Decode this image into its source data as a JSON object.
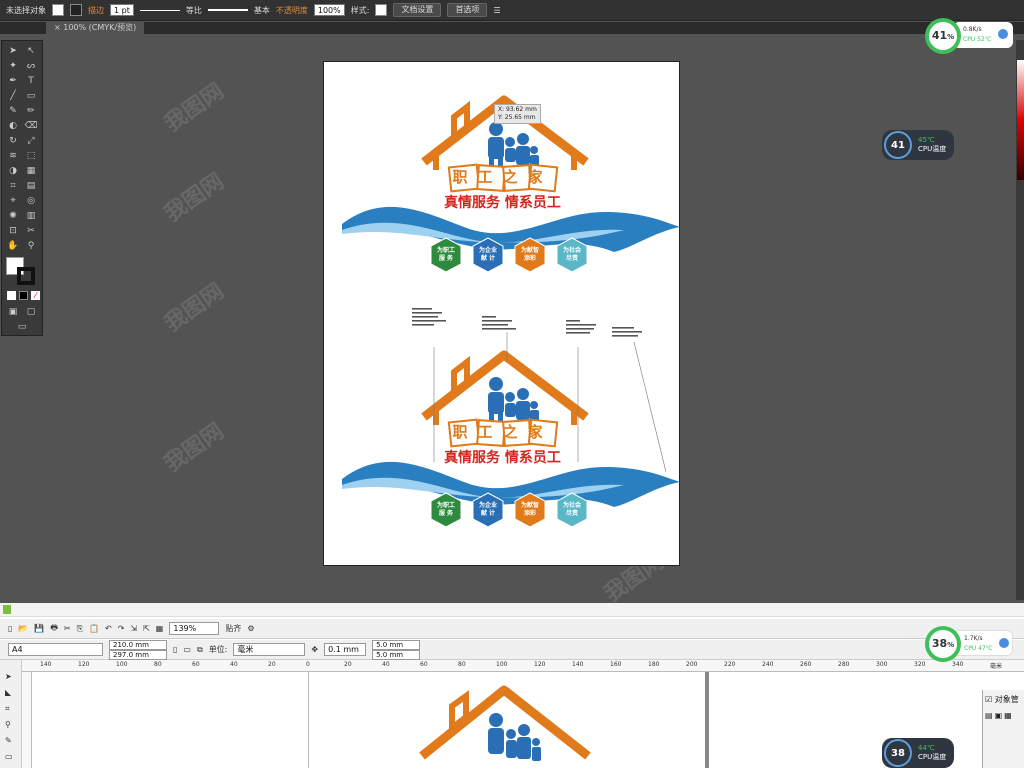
{
  "illustrator": {
    "control": {
      "selection": "未选择对象",
      "stroke_label": "描边",
      "stroke_value": "1 pt",
      "stroke_profile": "等比",
      "brush": "基本",
      "opacity_label": "不透明度",
      "opacity_value": "100%",
      "style_label": "样式:",
      "doc_setup": "文档设置",
      "prefs": "首选项"
    },
    "tab": "100% (CMYK/预览)",
    "tooltip": {
      "x": "X: 93.62 mm",
      "y": "Y: 25.65 mm"
    }
  },
  "design": {
    "title": "职工之家",
    "slogan": "真情服务 情系员工",
    "badges": [
      {
        "line1": "为职工",
        "line2": "服 务",
        "color": "#2e8b3e"
      },
      {
        "line1": "为企业",
        "line2": "献 计",
        "color": "#2a6fb6"
      },
      {
        "line1": "为献智",
        "line2": "添彩",
        "color": "#e07a1a"
      },
      {
        "line1": "为社会",
        "line2": "尽责",
        "color": "#5ab7c8"
      }
    ],
    "colors": {
      "house": "#e07a1a",
      "family": "#2a6fb6",
      "slogan": "#d4261e",
      "wave": "#2a7fc0"
    }
  },
  "coreldraw": {
    "zoom": "139%",
    "snap": "贴齐",
    "page_size": "A4",
    "width": "210.0 mm",
    "height": "297.0 mm",
    "units_label": "单位:",
    "units": "毫米",
    "nudge": "0.1 mm",
    "dup_x": "5.0 mm",
    "dup_y": "5.0 mm",
    "docker_title": "对象管",
    "ruler_ticks": [
      "140",
      "120",
      "100",
      "80",
      "60",
      "40",
      "20",
      "0",
      "20",
      "40",
      "60",
      "80",
      "100",
      "120",
      "140",
      "160",
      "180",
      "200",
      "220",
      "240",
      "260",
      "280",
      "300",
      "320",
      "340",
      "毫米"
    ]
  },
  "monitors": {
    "top_ring": "41",
    "top_unit": "%",
    "top_speed": "0.8K/s",
    "top_cpu": "CPU 52℃",
    "top_widget_pct": "41",
    "top_widget_temp": "45℃",
    "top_widget_label": "CPU温度",
    "bottom_ring": "38",
    "bottom_unit": "%",
    "bottom_speed": "1.7K/s",
    "bottom_cpu": "CPU 47℃",
    "bottom_widget_pct": "38",
    "bottom_widget_temp": "44℃",
    "bottom_widget_label": "CPU温度"
  },
  "watermark": "我图网"
}
